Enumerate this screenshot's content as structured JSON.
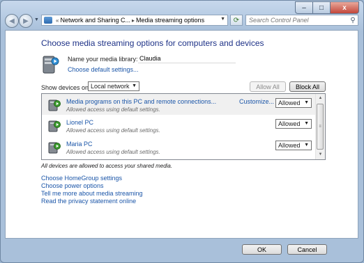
{
  "window": {
    "caption": {
      "minimize": "–",
      "maximize": "□",
      "close": "x"
    }
  },
  "nav": {
    "back_symbol": "◀",
    "forward_symbol": "▶",
    "breadcrumb": [
      "Network and Sharing C...",
      "Media streaming options"
    ],
    "breadcrumb_prefix": "«",
    "breadcrumb_separator": "▸",
    "search_placeholder": "Search Control Panel"
  },
  "main": {
    "title": "Choose media streaming options for computers and devices",
    "library_label": "Name your media library:",
    "library_value": "Claudia",
    "choose_default_settings": "Choose default settings...",
    "show_devices_label": "Show devices on:",
    "network_selected": "Local network",
    "allow_all": "Allow All",
    "block_all": "Block All",
    "devices": [
      {
        "name": "Media programs on this PC and remote connections...",
        "status": "Allowed access using default settings.",
        "customize": "Customize...",
        "permission": "Allowed"
      },
      {
        "name": "Lionel PC",
        "status": "Allowed access using default settings.",
        "customize": "",
        "permission": "Allowed"
      },
      {
        "name": "Maria PC",
        "status": "Allowed access using default settings.",
        "customize": "",
        "permission": "Allowed"
      }
    ],
    "all_devices_note": "All devices are allowed to access your shared media.",
    "links": [
      "Choose HomeGroup settings",
      "Choose power options",
      "Tell me more about media streaming",
      "Read the privacy statement online"
    ]
  },
  "footer": {
    "ok": "OK",
    "cancel": "Cancel"
  },
  "colors": {
    "link": "#1a55a8",
    "title": "#1e3287",
    "chrome": "#b6cbe3"
  },
  "icons": {
    "library": "media-library-icon",
    "device": "media-device-icon",
    "search": "magnifier-icon",
    "refresh": "refresh-icon",
    "address": "control-panel-icon"
  }
}
